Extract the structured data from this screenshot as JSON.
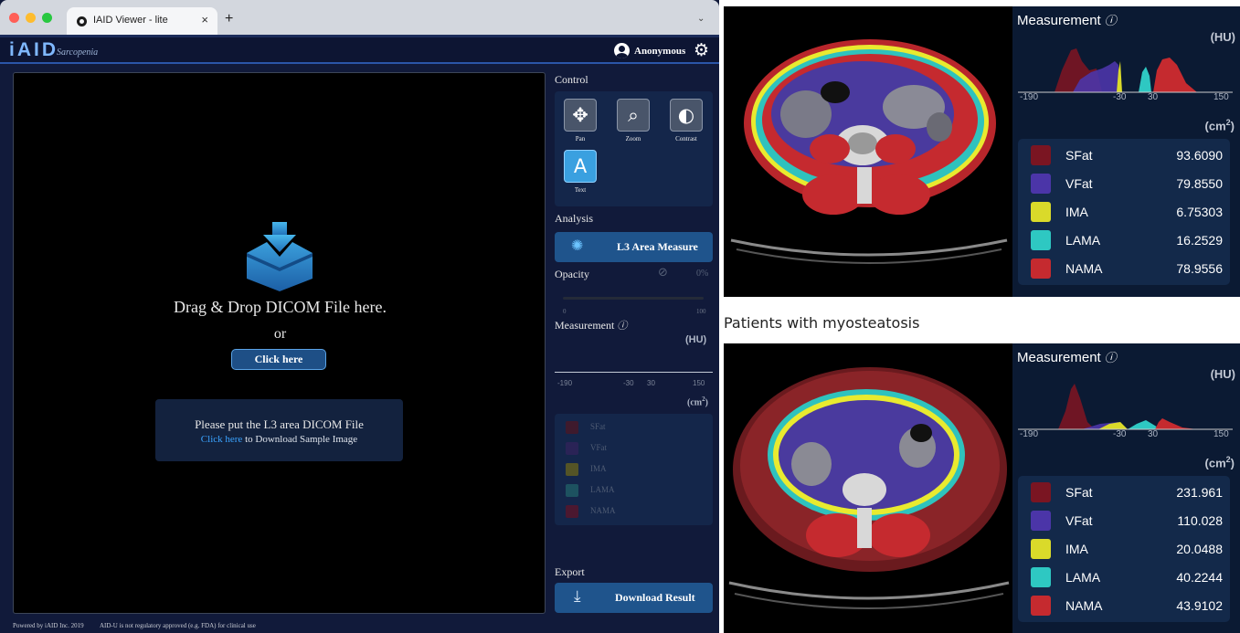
{
  "browser": {
    "tab_title": "IAID Viewer - lite",
    "tab_close": "×",
    "new_tab": "+",
    "tab_menu": "⌄",
    "traffic_lights": [
      "#ff5f57",
      "#febc2e",
      "#28c840"
    ]
  },
  "app": {
    "logo": "iAID",
    "logo_subtitle": "Sarcopenia",
    "user": "Anonymous",
    "colors": {
      "accent": "#3aa3ff",
      "panel": "#14264a",
      "button": "#1f548c",
      "background": "#111a3a"
    }
  },
  "viewer": {
    "drop_text": "Drag & Drop DICOM File here.",
    "or_text": "or",
    "click_button": "Click here",
    "info_title": "Please put the L3 area DICOM File",
    "info_link": "Click here",
    "info_rest": " to Download Sample Image"
  },
  "panel": {
    "control_label": "Control",
    "tools": [
      {
        "label": "Pan",
        "icon": "✥"
      },
      {
        "label": "Zoom",
        "icon": "⌕"
      },
      {
        "label": "Contrast",
        "icon": "◐"
      },
      {
        "label": "Text",
        "icon": "A"
      }
    ],
    "analysis_label": "Analysis",
    "l3_button": "L3 Area Measure",
    "opacity_label": "Opacity",
    "opacity_value": "0%",
    "opacity_min": "0",
    "opacity_max": "100",
    "measurement_label": "Measurement",
    "info_icon": "ⓘ",
    "hu_unit": "(HU)",
    "hu_ticks": [
      "-190",
      "-30",
      "30",
      "150"
    ],
    "area_unit": "(cm",
    "area_unit_sup": "2",
    "area_unit_close": ")",
    "legend": [
      {
        "name": "SFat",
        "color": "#3e1a2d"
      },
      {
        "name": "VFat",
        "color": "#2a2356"
      },
      {
        "name": "IMA",
        "color": "#545426"
      },
      {
        "name": "LAMA",
        "color": "#1d5260"
      },
      {
        "name": "NAMA",
        "color": "#4b1830"
      }
    ],
    "export_label": "Export",
    "download_button": "Download Result"
  },
  "footer": {
    "powered": "Powered by iAID Inc. 2019",
    "disclaimer": "AID-U is not regulatory approved (e.g. FDA) for clinical use"
  },
  "results": {
    "caption": "Patients with myosteatosis",
    "cases": [
      {
        "measurement_label": "Measurement",
        "hu_unit": "(HU)",
        "ticks": [
          "-190",
          "-30",
          "30",
          "150"
        ],
        "area_unit": "(cm",
        "area_unit_sup": "2",
        "area_unit_close": ")",
        "rows": [
          {
            "name": "SFat",
            "value": "93.6090",
            "color": "#7a1522"
          },
          {
            "name": "VFat",
            "value": "79.8550",
            "color": "#4b35a8"
          },
          {
            "name": "IMA",
            "value": "6.75303",
            "color": "#dada2a"
          },
          {
            "name": "LAMA",
            "value": "16.2529",
            "color": "#2ec8c2"
          },
          {
            "name": "NAMA",
            "value": "78.9556",
            "color": "#c52a2f"
          }
        ]
      },
      {
        "measurement_label": "Measurement",
        "hu_unit": "(HU)",
        "ticks": [
          "-190",
          "-30",
          "30",
          "150"
        ],
        "area_unit": "(cm",
        "area_unit_sup": "2",
        "area_unit_close": ")",
        "rows": [
          {
            "name": "SFat",
            "value": "231.961",
            "color": "#7a1522"
          },
          {
            "name": "VFat",
            "value": "110.028",
            "color": "#4b35a8"
          },
          {
            "name": "IMA",
            "value": "20.0488",
            "color": "#dada2a"
          },
          {
            "name": "LAMA",
            "value": "40.2244",
            "color": "#2ec8c2"
          },
          {
            "name": "NAMA",
            "value": "43.9102",
            "color": "#c52a2f"
          }
        ]
      }
    ]
  }
}
